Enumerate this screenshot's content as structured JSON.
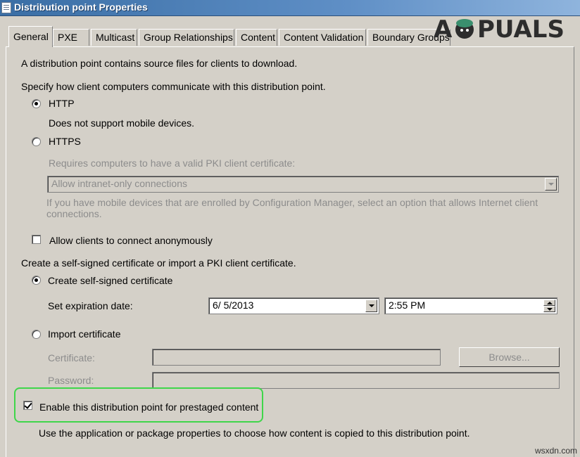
{
  "window": {
    "title": "Distribution point Properties"
  },
  "tabs": [
    "General",
    "PXE",
    "Multicast",
    "Group Relationships",
    "Content",
    "Content Validation",
    "Boundary Groups"
  ],
  "general": {
    "intro": "A distribution point contains source files for clients to download.",
    "comm_label": "Specify how client computers communicate with this distribution point.",
    "http_label": "HTTP",
    "http_note": "Does not support mobile devices.",
    "https_label": "HTTPS",
    "https_req": "Requires computers to have a valid PKI client certificate:",
    "https_option": "Allow intranet-only connections",
    "https_help_1": "If you have mobile devices that are enrolled by Configuration Manager, select an option that allows Internet client",
    "https_help_2": "connections.",
    "anon_label": "Allow clients to connect anonymously",
    "cert_label": "Create a self-signed certificate or import a PKI client certificate.",
    "selfsigned_label": "Create self-signed certificate",
    "expiration_label": "Set expiration date:",
    "expiration_date": "6/  5/2013",
    "expiration_time": "2:55 PM",
    "import_label": "Import certificate",
    "certificate_label": "Certificate:",
    "browse_label": "Browse...",
    "password_label": "Password:",
    "prestaged_label": "Enable this distribution point for prestaged content",
    "prestaged_note": "Use the application or package properties to choose how content is copied to this distribution point."
  },
  "state": {
    "http_selected": true,
    "https_selected": false,
    "anonymous_checked": false,
    "selfsigned_selected": true,
    "import_selected": false,
    "prestaged_checked": true,
    "highlight_color": "#3fd64a"
  },
  "watermark": {
    "logo": "A PUALS",
    "site": "wsxdn.com"
  }
}
